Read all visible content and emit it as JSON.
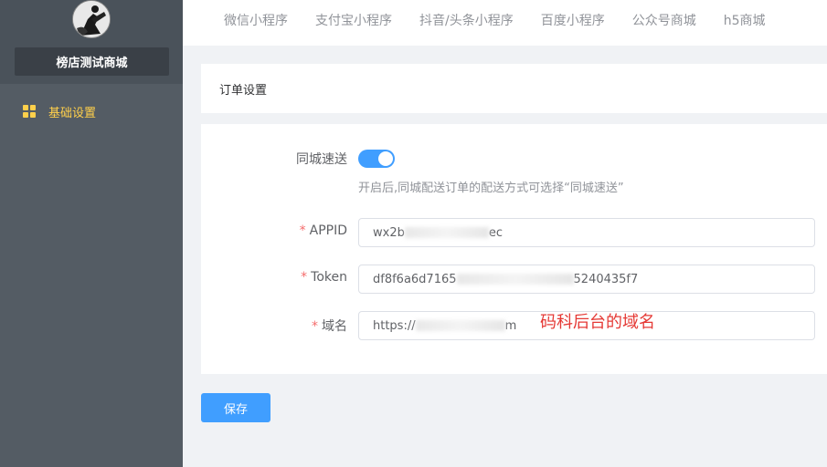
{
  "sidebar": {
    "shop_name": "榜店测试商城",
    "items": [
      {
        "label": "基础设置",
        "icon": "grid-icon",
        "active": true
      }
    ],
    "colors": {
      "bg": "#545c64",
      "active": "#ffd04b"
    }
  },
  "topnav": {
    "tabs": [
      "微信小程序",
      "支付宝小程序",
      "抖音/头条小程序",
      "百度小程序",
      "公众号商城",
      "h5商城"
    ]
  },
  "card": {
    "title": "订单设置"
  },
  "form": {
    "same_city": {
      "label": "同城速送",
      "enabled": true,
      "hint": "开启后,同城配送订单的配送方式可选择“同城速送”"
    },
    "appid": {
      "label": "APPID",
      "value_prefix": "wx2b",
      "value_suffix": "ec"
    },
    "token": {
      "label": "Token",
      "value_start": "df8f6a6d7165",
      "value_end": "5240435f7"
    },
    "domain": {
      "label": "域名",
      "value_prefix": "https://",
      "value_suffix": "m"
    },
    "annotation": "码科后台的域名"
  },
  "actions": {
    "save_label": "保存"
  },
  "colors": {
    "primary": "#409eff",
    "required": "#f56c6c",
    "annotation": "#e53935"
  }
}
